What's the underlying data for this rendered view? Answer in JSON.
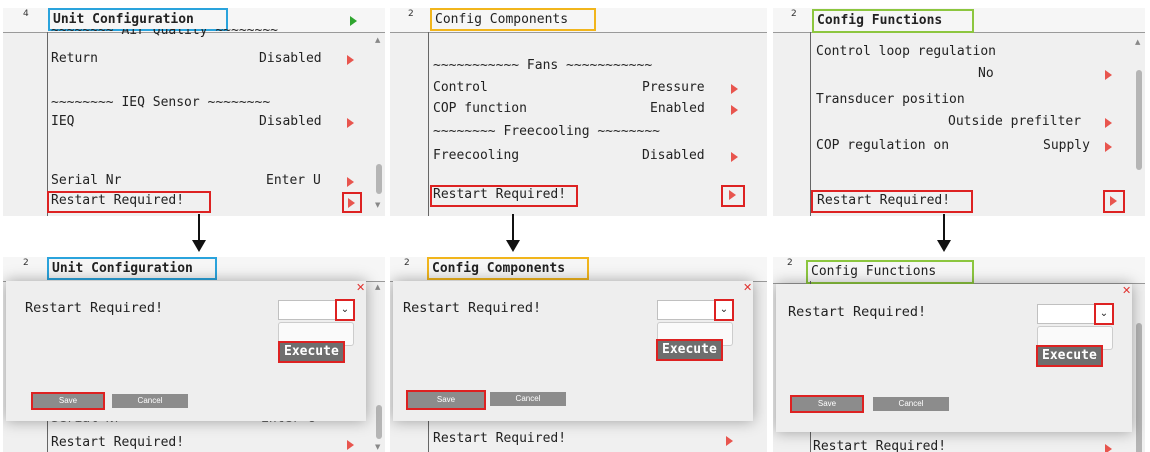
{
  "colors": {
    "blue": "#2aa3dc",
    "yellow": "#f1b51c",
    "green": "#8cc63f",
    "highlight": "#dd2222",
    "arrow": "#e8554e",
    "play": "#2fa52f"
  },
  "top": {
    "unit": {
      "number": "4",
      "title": "Unit Configuration",
      "rows": [
        {
          "label": "~~~~~~~~ Air Quality ~~~~~~~~"
        },
        {
          "label": "Return",
          "value": "Disabled"
        },
        {
          "label": "~~~~~~~~ IEQ Sensor ~~~~~~~~"
        },
        {
          "label": "IEQ",
          "value": "Disabled"
        },
        {
          "label": "Serial Nr",
          "value": "Enter U"
        },
        {
          "label": "Restart Required!"
        }
      ]
    },
    "components": {
      "number": "2",
      "title": "Config Components",
      "rows": [
        {
          "label": "~~~~~~~~~~~ Fans ~~~~~~~~~~~"
        },
        {
          "label": "Control",
          "value": "Pressure"
        },
        {
          "label": "COP function",
          "value": "Enabled"
        },
        {
          "label": "~~~~~~~~ Freecooling ~~~~~~~~"
        },
        {
          "label": "Freecooling",
          "value": "Disabled"
        },
        {
          "label": "Restart Required!"
        }
      ]
    },
    "functions": {
      "number": "2",
      "title": "Config Functions",
      "rows": [
        {
          "label": "Control loop regulation"
        },
        {
          "label": "",
          "value": "No"
        },
        {
          "label": "Transducer position"
        },
        {
          "label": "",
          "value": "Outside prefilter"
        },
        {
          "label": "COP regulation on",
          "value": "Supply"
        },
        {
          "label": "Restart Required!"
        }
      ]
    }
  },
  "bottom": {
    "unit": {
      "number": "2",
      "title": "Unit Configuration",
      "dialog_label": "Restart Required!",
      "option": "Execute",
      "save": "Save",
      "cancel": "Cancel",
      "behind_label": "Restart Required!",
      "behind_partial": "Serial Nr",
      "behind_value": "Enter U"
    },
    "components": {
      "number": "2",
      "title": "Config Components",
      "dialog_label": "Restart Required!",
      "option": "Execute",
      "save": "Save",
      "cancel": "Cancel",
      "behind_label": "Restart Required!"
    },
    "functions": {
      "number": "2",
      "title": "Config Functions",
      "dialog_label": "Restart Required!",
      "option": "Execute",
      "save": "Save",
      "cancel": "Cancel",
      "behind_label": "Restart Required!"
    }
  },
  "icons": {
    "close": "close-icon",
    "dropdown": "chevron-down-icon",
    "arrow": "play-arrow-icon"
  }
}
